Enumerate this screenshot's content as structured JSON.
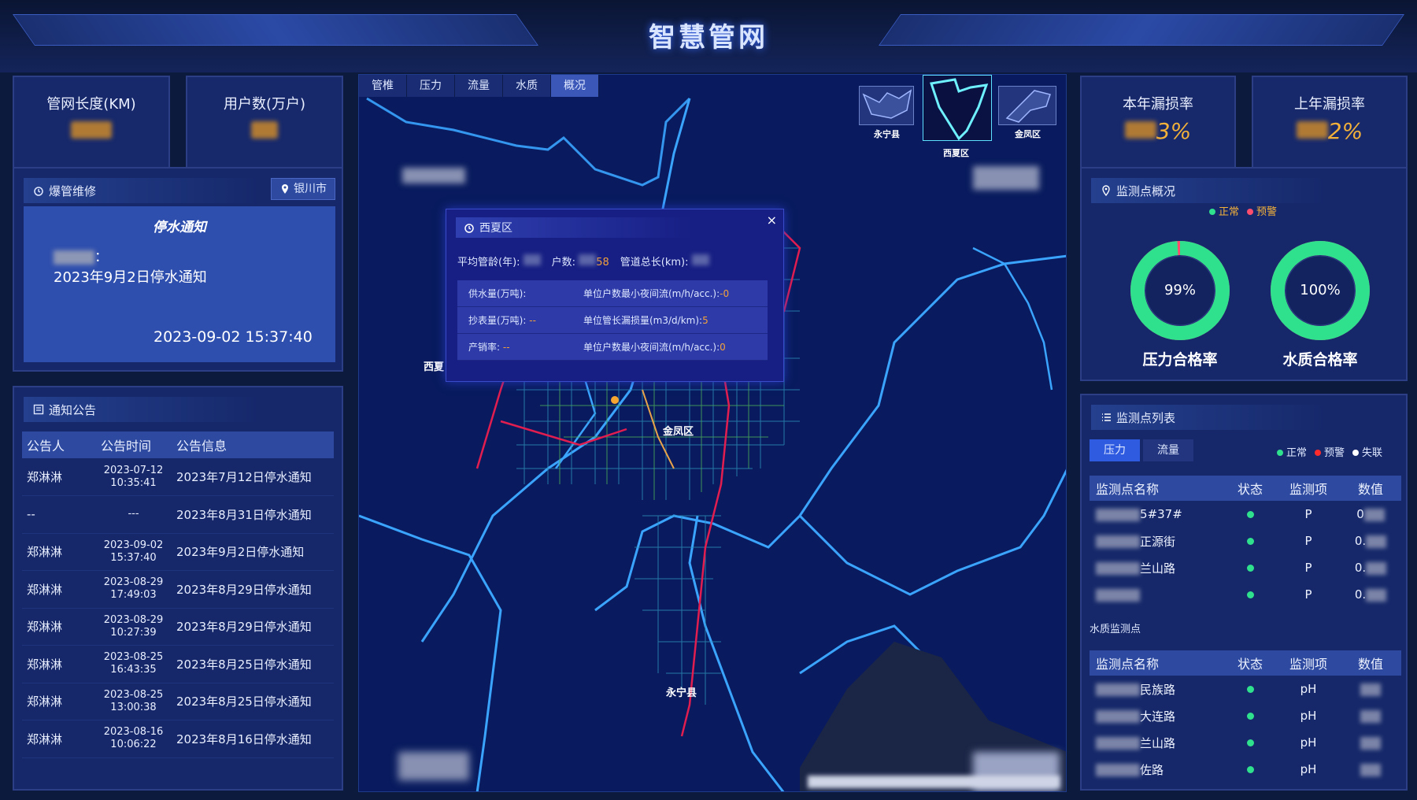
{
  "header": {
    "title": "智慧管网"
  },
  "stats": {
    "pipe_length_label": "管网长度(KM)",
    "users_label": "用户数(万户)",
    "this_year_leak_label": "本年漏损率",
    "this_year_leak_suffix": "3%",
    "last_year_leak_label": "上年漏损率",
    "last_year_leak_suffix": "2%"
  },
  "repair": {
    "title": "爆管维修",
    "city_button": "银川市",
    "notice_title": "停水通知",
    "notice_line1": "：",
    "notice_line2": "2023年9月2日停水通知",
    "notice_date": "2023-09-02 15:37:40"
  },
  "announcements": {
    "title": "通知公告",
    "columns": [
      "公告人",
      "公告时间",
      "公告信息"
    ],
    "rows": [
      {
        "person": "郑淋淋",
        "date": "2023-07-12",
        "time": "10:35:41",
        "info": "2023年7月12日停水通知"
      },
      {
        "person": "--",
        "date": "---",
        "time": "",
        "info": "2023年8月31日停水通知"
      },
      {
        "person": "郑淋淋",
        "date": "2023-09-02",
        "time": "15:37:40",
        "info": "2023年9月2日停水通知"
      },
      {
        "person": "郑淋淋",
        "date": "2023-08-29",
        "time": "17:49:03",
        "info": "2023年8月29日停水通知"
      },
      {
        "person": "郑淋淋",
        "date": "2023-08-29",
        "time": "10:27:39",
        "info": "2023年8月29日停水通知"
      },
      {
        "person": "郑淋淋",
        "date": "2023-08-25",
        "time": "16:43:35",
        "info": "2023年8月25日停水通知"
      },
      {
        "person": "郑淋淋",
        "date": "2023-08-25",
        "time": "13:00:38",
        "info": "2023年8月25日停水通知"
      },
      {
        "person": "郑淋淋",
        "date": "2023-08-16",
        "time": "10:06:22",
        "info": "2023年8月16日停水通知"
      }
    ]
  },
  "map": {
    "tabs": [
      "管椎",
      "压力",
      "流量",
      "水质",
      "概况"
    ],
    "active_tab": "概况",
    "thumbnails": [
      "永宁县",
      "西夏区",
      "金凤区"
    ],
    "labels": {
      "xixia": "西夏",
      "jinfeng": "金凤区",
      "yongning": "永宁县"
    },
    "popup": {
      "title": "西夏区",
      "close": "×",
      "avg_age_label": "平均管龄(年):",
      "households_label": "户数:",
      "households_suffix": "58",
      "pipe_length_label": "管道总长(km):",
      "rows": [
        {
          "left": "供水量(万吨):",
          "left_val": "",
          "right": "单位户数最小夜间流(m/h/acc.):",
          "right_val": "-0"
        },
        {
          "left": "抄表量(万吨):",
          "left_val": "--",
          "right": "单位管长漏损量(m3/d/km):",
          "right_val": "5"
        },
        {
          "left": "产销率:",
          "left_val": "--",
          "right": "单位户数最小夜间流(m/h/acc.):",
          "right_val": "0"
        }
      ]
    }
  },
  "monitor_overview": {
    "title": "监测点概况",
    "legend": [
      "正常",
      "预警"
    ],
    "pressure_rate": "99%",
    "pressure_label": "压力合格率",
    "pressure_value": 0.99,
    "quality_rate": "100%",
    "quality_label": "水质合格率",
    "quality_value": 1.0,
    "colors": {
      "normal": "#2fe08d",
      "warning": "#ff4d6d"
    }
  },
  "monitor_list": {
    "title": "监测点列表",
    "tabs": [
      "压力",
      "流量"
    ],
    "legend": [
      "正常",
      "预警",
      "失联"
    ],
    "columns": [
      "监测点名称",
      "状态",
      "监测项",
      "数值"
    ],
    "pressure_rows": [
      {
        "name": "5#37#",
        "item": "P",
        "value": "0"
      },
      {
        "name": "正源街",
        "item": "P",
        "value": "0."
      },
      {
        "name": "兰山路",
        "item": "P",
        "value": "0."
      },
      {
        "name": "",
        "item": "P",
        "value": "0."
      }
    ],
    "water_quality_title": "水质监测点",
    "quality_rows": [
      {
        "name": "民族路",
        "item": "pH",
        "value": ""
      },
      {
        "name": "大连路",
        "item": "pH",
        "value": ""
      },
      {
        "name": "兰山路",
        "item": "pH",
        "value": ""
      },
      {
        "name": "佐路",
        "item": "pH",
        "value": ""
      }
    ]
  }
}
